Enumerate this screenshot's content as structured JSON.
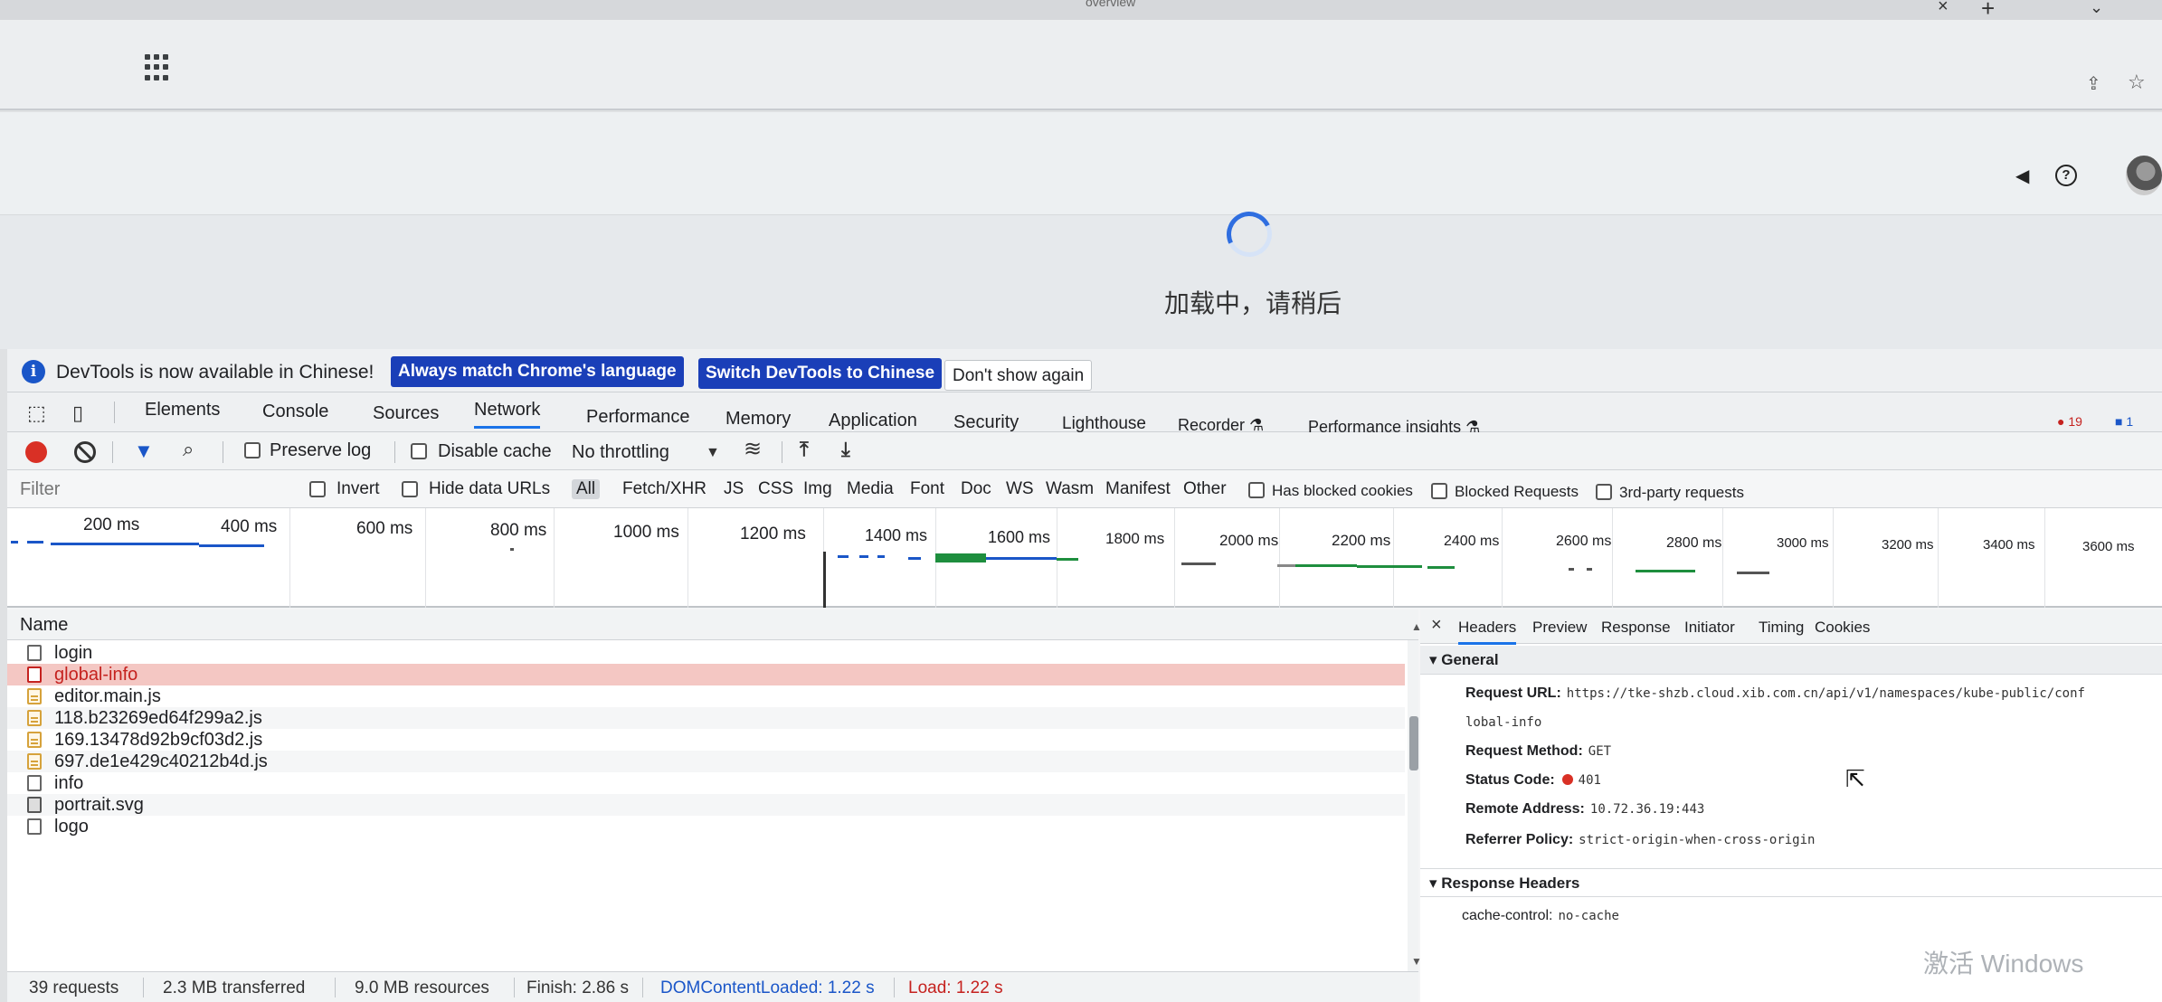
{
  "browser": {
    "tab_title": "overview",
    "close_glyph": "×",
    "new_tab_glyph": "+",
    "menu_glyph": "⌄",
    "share_glyph": "⇪",
    "star_glyph": "☆"
  },
  "app_header": {
    "speaker_glyph": "◀",
    "help_glyph": "?"
  },
  "page": {
    "loading_text": "加载中，请稍后"
  },
  "infobar": {
    "icon": "i",
    "message": "DevTools is now available in Chinese!",
    "btn_match": "Always match Chrome's language",
    "btn_switch": "Switch DevTools to Chinese",
    "btn_dismiss": "Don't show again"
  },
  "panel_tabs": {
    "inspect_glyph": "⬚",
    "device_glyph": "▯",
    "tabs": [
      "Elements",
      "Console",
      "Sources",
      "Network",
      "Performance",
      "Memory",
      "Application",
      "Security",
      "Lighthouse",
      "Recorder ⚗",
      "Performance insights ⚗"
    ],
    "errors": "● 19",
    "messages": "■ 1"
  },
  "net_toolbar": {
    "filter_glyph": "▼",
    "search_glyph": "⌕",
    "preserve_log": "Preserve log",
    "disable_cache": "Disable cache",
    "throttling": "No throttling",
    "dropdown_glyph": "▼",
    "wifi_glyph": "≋",
    "upload_glyph": "⤒",
    "download_glyph": "⤓"
  },
  "filter_bar": {
    "placeholder": "Filter",
    "invert": "Invert",
    "hide_data_urls": "Hide data URLs",
    "types": [
      "All",
      "Fetch/XHR",
      "JS",
      "CSS",
      "Img",
      "Media",
      "Font",
      "Doc",
      "WS",
      "Wasm",
      "Manifest",
      "Other"
    ],
    "has_blocked_cookies": "Has blocked cookies",
    "blocked_requests": "Blocked Requests",
    "third_party": "3rd-party requests"
  },
  "overview": {
    "ticks": [
      "200 ms",
      "400 ms",
      "600 ms",
      "800 ms",
      "1000 ms",
      "1200 ms",
      "1400 ms",
      "1600 ms",
      "1800 ms",
      "2000 ms",
      "2200 ms",
      "2400 ms",
      "2600 ms",
      "2800 ms",
      "3000 ms",
      "3200 ms",
      "3400 ms",
      "3600 ms"
    ]
  },
  "request_list": {
    "column_name": "Name",
    "scroll_up": "▲",
    "scroll_down": "▼",
    "rows": [
      {
        "name": "login",
        "type": "doc",
        "error": false
      },
      {
        "name": "global-info",
        "type": "doc",
        "error": true
      },
      {
        "name": "editor.main.js",
        "type": "js",
        "error": false
      },
      {
        "name": "118.b23269ed64f299a2.js",
        "type": "js",
        "error": false
      },
      {
        "name": "169.13478d92b9cf03d2.js",
        "type": "js",
        "error": false
      },
      {
        "name": "697.de1e429c40212b4d.js",
        "type": "js",
        "error": false
      },
      {
        "name": "info",
        "type": "doc",
        "error": false
      },
      {
        "name": "portrait.svg",
        "type": "svg",
        "error": false
      },
      {
        "name": "logo",
        "type": "doc",
        "error": false
      }
    ]
  },
  "details": {
    "close_glyph": "×",
    "tabs": [
      "Headers",
      "Preview",
      "Response",
      "Initiator",
      "Timing",
      "Cookies"
    ],
    "general_title": "▾ General",
    "request_url_key": "Request URL:",
    "request_url_value": "https://tke-shzb.cloud.xib.com.cn/api/v1/namespaces/kube-public/conf",
    "request_url_cont": "lobal-info",
    "request_method_key": "Request Method:",
    "request_method_value": "GET",
    "status_code_key": "Status Code:",
    "status_code_value": "401",
    "remote_address_key": "Remote Address:",
    "remote_address_value": "10.72.36.19:443",
    "referrer_policy_key": "Referrer Policy:",
    "referrer_policy_value": "strict-origin-when-cross-origin",
    "response_headers_title": "▾ Response Headers",
    "cache_control_key": "cache-control:",
    "cache_control_value": "no-cache"
  },
  "status_bar": {
    "requests": "39 requests",
    "transferred": "2.3 MB transferred",
    "resources": "9.0 MB resources",
    "finish": "Finish: 2.86 s",
    "dom_content_loaded": "DOMContentLoaded: 1.22 s",
    "load": "Load: 1.22 s"
  },
  "watermark": "激活 Windows",
  "cursor_glyph": "⇱"
}
